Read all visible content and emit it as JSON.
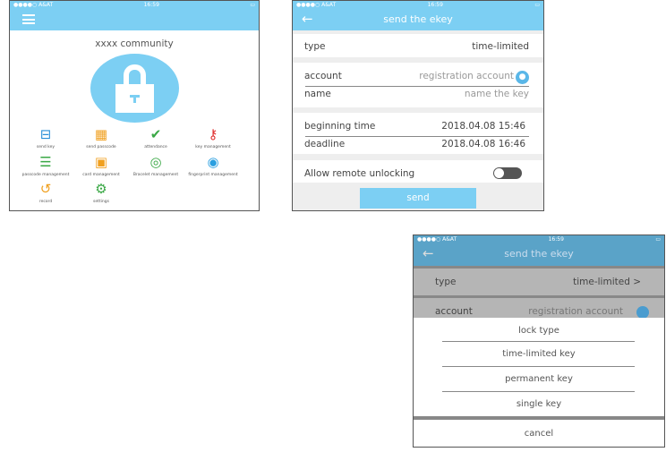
{
  "home": {
    "status": {
      "carrier": "●●●●○ A&AT",
      "time": "16:59"
    },
    "title": "xxxx community",
    "menu": [
      {
        "label": "send key",
        "icon": "card-key-icon",
        "color": "#2a8fd8",
        "glyph": "⊟"
      },
      {
        "label": "send passcode",
        "icon": "keypad-icon",
        "color": "#f0a020",
        "glyph": "▦"
      },
      {
        "label": "attendance",
        "icon": "check-pin-icon",
        "color": "#3aa845",
        "glyph": "✔"
      },
      {
        "label": "key management",
        "icon": "keys-icon",
        "color": "#e03030",
        "glyph": "⚷"
      },
      {
        "label": "passcode management",
        "icon": "list-icon",
        "color": "#3aa845",
        "glyph": "☰"
      },
      {
        "label": "card management",
        "icon": "cards-icon",
        "color": "#f0a020",
        "glyph": "▣"
      },
      {
        "label": "Bracelet management",
        "icon": "bracelet-icon",
        "color": "#3aa845",
        "glyph": "◎"
      },
      {
        "label": "fingerprint management",
        "icon": "fingerprint-icon",
        "color": "#2a9fe0",
        "glyph": "◉"
      },
      {
        "label": "record",
        "icon": "history-icon",
        "color": "#f0a020",
        "glyph": "↺"
      },
      {
        "label": "settings",
        "icon": "gear-icon",
        "color": "#3aa845",
        "glyph": "⚙"
      }
    ]
  },
  "send": {
    "status": {
      "carrier": "●●●●○ A&AT",
      "time": "16:59"
    },
    "title": "send the ekey",
    "type_label": "type",
    "type_value": "time-limited",
    "account_label": "account",
    "account_placeholder": "registration account",
    "name_label": "name",
    "name_placeholder": "name the key",
    "begin_label": "beginning time",
    "begin_value": "2018.04.08 15:46",
    "deadline_label": "deadline",
    "deadline_value": "2018.04.08 16:46",
    "remote_label": "Allow remote unlocking",
    "remote_on": false,
    "send_label": "send"
  },
  "sheet": {
    "status": {
      "carrier": "●●●●○ A&AT",
      "time": "16:59"
    },
    "title": "send the ekey",
    "type_label": "type",
    "type_value": "time-limited >",
    "account_label": "account",
    "account_placeholder": "registration account",
    "heading": "lock type",
    "options": [
      "time-limited key",
      "permanent key",
      "single key"
    ],
    "cancel": "cancel"
  }
}
